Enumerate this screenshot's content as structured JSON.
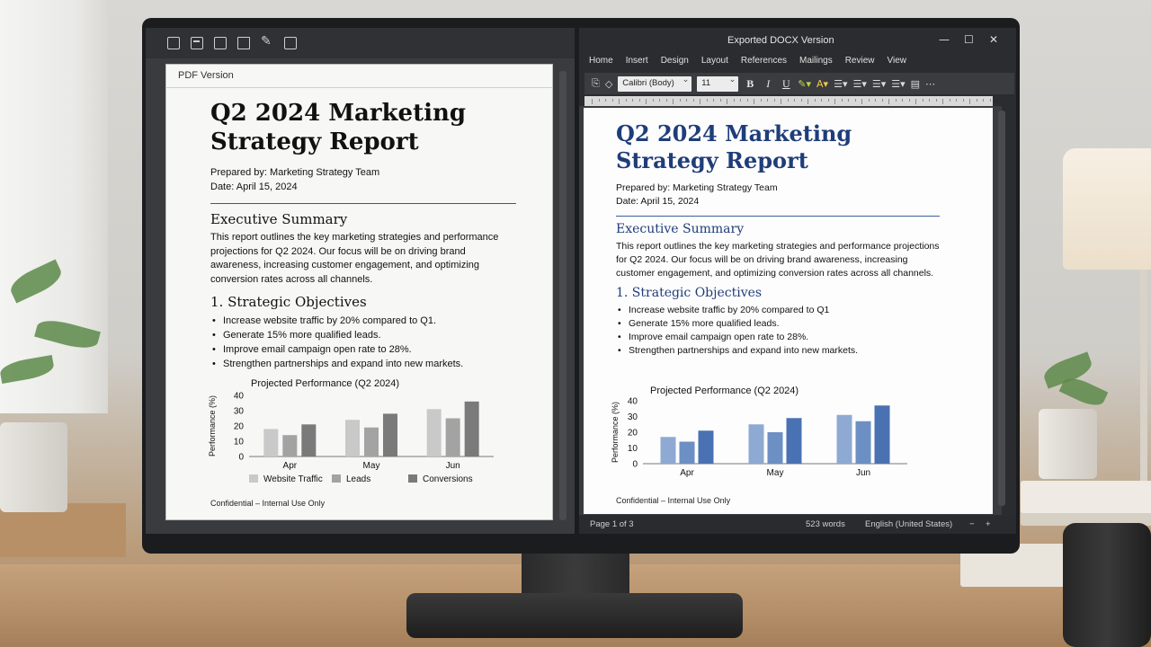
{
  "pdf": {
    "header": "PDF Version",
    "title_line1": "Q2 2024 Marketing",
    "title_line2": "Strategy Report",
    "prepared_by": "Prepared by: Marketing Strategy Team",
    "date": "Date: April 15, 2024",
    "exec_heading": "Executive Summary",
    "exec_text": "This report outlines the key marketing strategies and performance projections for Q2 2024. Our focus will be on driving brand awareness, increasing customer engagement, and optimizing conversion rates across all channels.",
    "objectives_heading": "1. Strategic Objectives",
    "objectives": [
      "Increase website traffic by 20% compared to Q1.",
      "Generate 15% more qualified leads.",
      "Improve email campaign open rate to 28%.",
      "Strengthen partnerships and expand into new markets."
    ],
    "footer": "Confidential – Internal Use Only",
    "colors": [
      "#c9c9c9",
      "#a3a3a3",
      "#7a7a7a"
    ]
  },
  "word": {
    "window_title": "Exported DOCX Version",
    "tabs": [
      "Home",
      "Insert",
      "Design",
      "Layout",
      "References",
      "Mailings",
      "Review",
      "View"
    ],
    "font_name": "Calibri (Body)",
    "font_size": "11",
    "bold_label": "B",
    "italic_label": "I",
    "underline_label": "U",
    "title_line1": "Q2 2024 Marketing",
    "title_line2": "Strategy Report",
    "prepared_by": "Prepared by: Marketing Strategy Team",
    "date": "Date: April 15, 2024",
    "exec_heading": "Executive Summary",
    "exec_text": "This report outlines the key marketing strategies and performance projections for Q2 2024. Our focus will be on driving brand awareness, increasing customer engagement, and optimizing conversion rates across all channels.",
    "objectives_heading": "1. Strategic Objectives",
    "objectives": [
      "Increase website traffic by 20% compared to Q1",
      "Generate 15% more qualified leads.",
      "Improve email campaign open rate to 28%.",
      "Strengthen partnerships and expand into new markets."
    ],
    "footer": "Confidential – Internal Use Only",
    "status_page": "Page 1 of 3",
    "status_words": "523 words",
    "status_lang": "English (United States)",
    "colors": [
      "#8eaad3",
      "#6c8fc4",
      "#4a72b2"
    ]
  },
  "chart_data": [
    {
      "type": "bar",
      "title": "Projected Performance (Q2 2024)",
      "ylabel": "Performance (%)",
      "xlabel": "",
      "categories": [
        "Apr",
        "May",
        "Jun"
      ],
      "series": [
        {
          "name": "Website Traffic",
          "values": [
            18,
            24,
            31
          ]
        },
        {
          "name": "Leads",
          "values": [
            14,
            19,
            25
          ]
        },
        {
          "name": "Conversions",
          "values": [
            21,
            28,
            36
          ]
        }
      ],
      "ylim": [
        0,
        40
      ],
      "yticks": [
        0,
        10,
        20,
        30,
        40
      ],
      "legend": "bottom"
    },
    {
      "type": "bar",
      "title": "Projected Performance (Q2 2024)",
      "ylabel": "Performance (%)",
      "xlabel": "",
      "categories": [
        "Apr",
        "May",
        "Jun"
      ],
      "series": [
        {
          "values": [
            17,
            25,
            31
          ]
        },
        {
          "values": [
            14,
            20,
            27
          ]
        },
        {
          "values": [
            21,
            29,
            37
          ]
        }
      ],
      "ylim": [
        0,
        40
      ],
      "yticks": [
        0,
        10,
        20,
        30,
        40
      ]
    }
  ]
}
